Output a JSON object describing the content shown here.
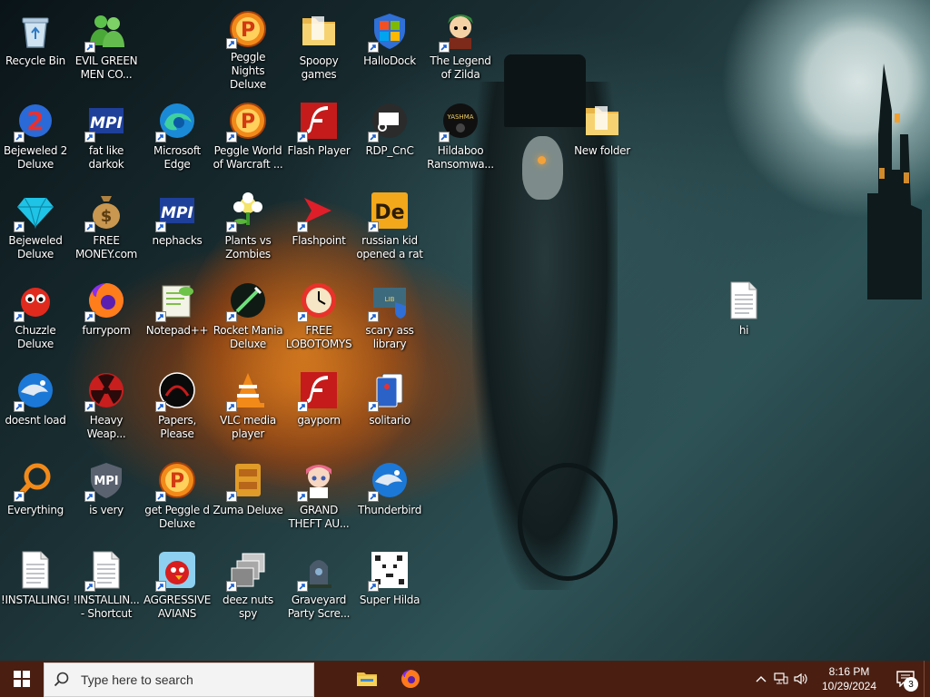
{
  "desktop": {
    "icons": [
      {
        "label": "Recycle Bin",
        "icon": "recycle-bin-icon",
        "shortcut": false
      },
      {
        "label": "EVIL GREEN MEN CO...",
        "icon": "messenger-icon",
        "shortcut": true
      },
      {
        "label": "Peggle Nights Deluxe",
        "icon": "peggle-icon",
        "shortcut": true
      },
      {
        "label": "Spoopy games",
        "icon": "folder-icon",
        "shortcut": false
      },
      {
        "label": "HalloDock",
        "icon": "windows-shield-icon",
        "shortcut": true
      },
      {
        "label": "The Legend of Zilda",
        "icon": "zelda-icon",
        "shortcut": true
      },
      {
        "label": "Bejeweled 2 Deluxe",
        "icon": "bejeweled2-icon",
        "shortcut": true
      },
      {
        "label": "fat like darkok",
        "icon": "mpi-icon",
        "shortcut": true
      },
      {
        "label": "Microsoft Edge",
        "icon": "edge-icon",
        "shortcut": true
      },
      {
        "label": "Peggle World of Warcraft ...",
        "icon": "peggle-icon",
        "shortcut": true
      },
      {
        "label": "Flash Player",
        "icon": "flash-icon",
        "shortcut": true
      },
      {
        "label": "RDP_CnC",
        "icon": "rdp-icon",
        "shortcut": true
      },
      {
        "label": "Hildaboo Ransomwa...",
        "icon": "yashma-icon",
        "shortcut": true
      },
      {
        "label": "New folder",
        "icon": "folder-icon",
        "shortcut": false
      },
      {
        "label": "Bejeweled Deluxe",
        "icon": "diamond-icon",
        "shortcut": true
      },
      {
        "label": "FREE MONEY.com",
        "icon": "money-bag-icon",
        "shortcut": true
      },
      {
        "label": "nephacks",
        "icon": "mpi-icon",
        "shortcut": true
      },
      {
        "label": "Plants vs Zombies",
        "icon": "pvz-icon",
        "shortcut": true
      },
      {
        "label": "Flashpoint",
        "icon": "flashpoint-icon",
        "shortcut": true
      },
      {
        "label": "russian kid opened a rat",
        "icon": "de-icon",
        "shortcut": true
      },
      {
        "label": "hi",
        "icon": "text-file-icon",
        "shortcut": false
      },
      {
        "label": "Chuzzle Deluxe",
        "icon": "chuzzle-icon",
        "shortcut": true
      },
      {
        "label": "furryporn",
        "icon": "firefox-icon",
        "shortcut": true
      },
      {
        "label": "Notepad++",
        "icon": "notepadpp-icon",
        "shortcut": true
      },
      {
        "label": "Rocket Mania Deluxe",
        "icon": "rocket-mania-icon",
        "shortcut": true
      },
      {
        "label": "FREE LOBOTOMYS",
        "icon": "clock-icon",
        "shortcut": true
      },
      {
        "label": "scary ass library",
        "icon": "library-shield-icon",
        "shortcut": true
      },
      {
        "label": "doesnt load",
        "icon": "thunderbird-icon",
        "shortcut": true
      },
      {
        "label": "Heavy Weap...",
        "icon": "radiation-icon",
        "shortcut": true
      },
      {
        "label": "Papers, Please",
        "icon": "papers-please-icon",
        "shortcut": true
      },
      {
        "label": "VLC media player",
        "icon": "vlc-icon",
        "shortcut": true
      },
      {
        "label": "gayporn",
        "icon": "flash-icon",
        "shortcut": true
      },
      {
        "label": "solitario",
        "icon": "solitaire-icon",
        "shortcut": true
      },
      {
        "label": "Everything",
        "icon": "everything-icon",
        "shortcut": true
      },
      {
        "label": "is very",
        "icon": "mpi-shield-icon",
        "shortcut": true
      },
      {
        "label": "get Peggle d Deluxe",
        "icon": "peggle-icon",
        "shortcut": true
      },
      {
        "label": "Zuma Deluxe",
        "icon": "zuma-icon",
        "shortcut": true
      },
      {
        "label": "GRAND THEFT AU...",
        "icon": "anime-girl-icon",
        "shortcut": true
      },
      {
        "label": "Thunderbird",
        "icon": "thunderbird-icon",
        "shortcut": true
      },
      {
        "label": "!INSTALLING!",
        "icon": "text-file-icon",
        "shortcut": false
      },
      {
        "label": "!INSTALLIN... - Shortcut",
        "icon": "text-file-icon",
        "shortcut": true
      },
      {
        "label": "AGGRESSIVE AVIANS",
        "icon": "angry-bird-icon",
        "shortcut": true
      },
      {
        "label": "deez nuts spy",
        "icon": "stacked-windows-icon",
        "shortcut": true
      },
      {
        "label": "Graveyard Party Scre...",
        "icon": "graveyard-icon",
        "shortcut": true
      },
      {
        "label": "Super Hilda",
        "icon": "pixel-cat-icon",
        "shortcut": true
      }
    ]
  },
  "taskbar": {
    "search_placeholder": "Type here to search",
    "pinned": [
      {
        "name": "File Explorer",
        "icon": "file-explorer-icon"
      },
      {
        "name": "Firefox",
        "icon": "firefox-icon"
      }
    ],
    "clock_time": "8:16 PM",
    "clock_date": "10/29/2024",
    "notification_count": "3"
  },
  "colors": {
    "taskbar": "#4a1f12",
    "search_bg": "#f3f3f3"
  }
}
